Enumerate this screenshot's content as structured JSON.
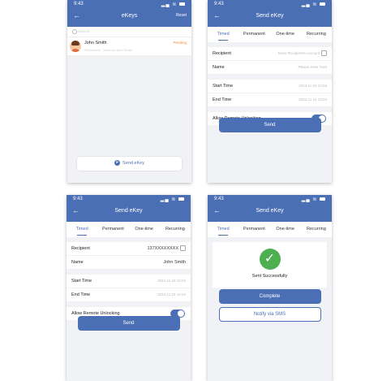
{
  "status_time": "9:43",
  "screens": {
    "ekeys": {
      "title": "eKeys",
      "action": "Reset",
      "search_placeholder": "Search",
      "item": {
        "name": "John Smith",
        "subtitle": "Permanent · Send by John Smith",
        "status": "Pending"
      },
      "send_label": "Send eKey"
    },
    "send_empty": {
      "title": "Send eKey",
      "tabs": [
        "Timed",
        "Permanent",
        "One-time",
        "Recurring"
      ],
      "fields": {
        "recipient_label": "Recipient",
        "recipient_placeholder": "Enter Recipient's Account",
        "name_label": "Name",
        "name_placeholder": "Please enter here",
        "start_label": "Start Time",
        "start_value": "2024.11.18 10:04",
        "end_label": "End Time",
        "end_value": "2024.11.24 10:04",
        "remote_label": "Allow Remote Unlocking"
      },
      "send_button": "Send"
    },
    "send_filled": {
      "title": "Send eKey",
      "tabs": [
        "Timed",
        "Permanent",
        "One-time",
        "Recurring"
      ],
      "fields": {
        "recipient_label": "Recipient",
        "recipient_value": "137XXXXXXXX",
        "name_label": "Name",
        "name_value": "John Smith",
        "start_label": "Start Time",
        "start_value": "2024.11.18 10:04",
        "end_label": "End Time",
        "end_value": "2024.11.24 10:04",
        "remote_label": "Allow Remote Unlocking"
      },
      "send_button": "Send"
    },
    "success": {
      "title": "Send eKey",
      "tabs": [
        "Timed",
        "Permanent",
        "One-time",
        "Recurring"
      ],
      "message": "Sent Successfully",
      "complete_button": "Complete",
      "sms_button": "Notify via SMS"
    }
  },
  "colors": {
    "primary": "#4b6fb5",
    "success": "#4caf50",
    "pending": "#f08c3c"
  }
}
